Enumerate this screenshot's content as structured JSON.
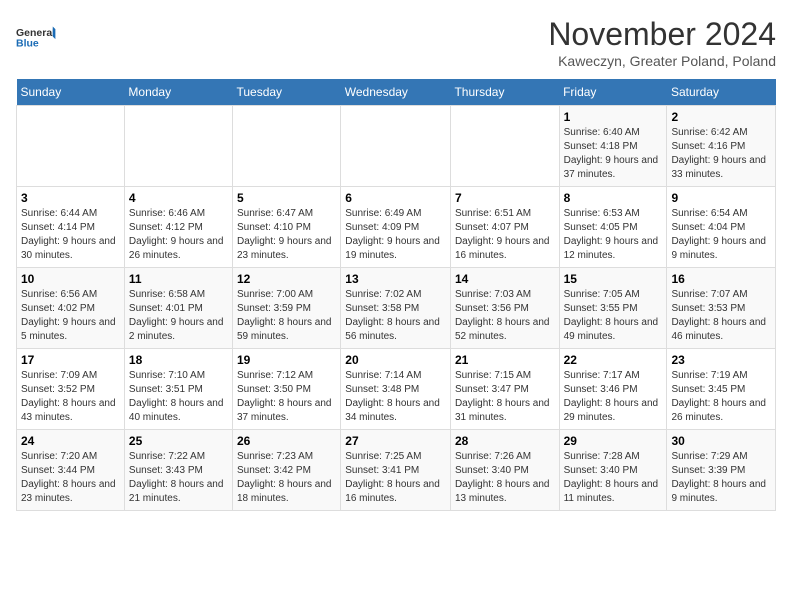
{
  "logo": {
    "line1": "General",
    "line2": "Blue"
  },
  "title": "November 2024",
  "subtitle": "Kaweczyn, Greater Poland, Poland",
  "days_of_week": [
    "Sunday",
    "Monday",
    "Tuesday",
    "Wednesday",
    "Thursday",
    "Friday",
    "Saturday"
  ],
  "weeks": [
    [
      {
        "day": "",
        "info": ""
      },
      {
        "day": "",
        "info": ""
      },
      {
        "day": "",
        "info": ""
      },
      {
        "day": "",
        "info": ""
      },
      {
        "day": "",
        "info": ""
      },
      {
        "day": "1",
        "info": "Sunrise: 6:40 AM\nSunset: 4:18 PM\nDaylight: 9 hours and 37 minutes."
      },
      {
        "day": "2",
        "info": "Sunrise: 6:42 AM\nSunset: 4:16 PM\nDaylight: 9 hours and 33 minutes."
      }
    ],
    [
      {
        "day": "3",
        "info": "Sunrise: 6:44 AM\nSunset: 4:14 PM\nDaylight: 9 hours and 30 minutes."
      },
      {
        "day": "4",
        "info": "Sunrise: 6:46 AM\nSunset: 4:12 PM\nDaylight: 9 hours and 26 minutes."
      },
      {
        "day": "5",
        "info": "Sunrise: 6:47 AM\nSunset: 4:10 PM\nDaylight: 9 hours and 23 minutes."
      },
      {
        "day": "6",
        "info": "Sunrise: 6:49 AM\nSunset: 4:09 PM\nDaylight: 9 hours and 19 minutes."
      },
      {
        "day": "7",
        "info": "Sunrise: 6:51 AM\nSunset: 4:07 PM\nDaylight: 9 hours and 16 minutes."
      },
      {
        "day": "8",
        "info": "Sunrise: 6:53 AM\nSunset: 4:05 PM\nDaylight: 9 hours and 12 minutes."
      },
      {
        "day": "9",
        "info": "Sunrise: 6:54 AM\nSunset: 4:04 PM\nDaylight: 9 hours and 9 minutes."
      }
    ],
    [
      {
        "day": "10",
        "info": "Sunrise: 6:56 AM\nSunset: 4:02 PM\nDaylight: 9 hours and 5 minutes."
      },
      {
        "day": "11",
        "info": "Sunrise: 6:58 AM\nSunset: 4:01 PM\nDaylight: 9 hours and 2 minutes."
      },
      {
        "day": "12",
        "info": "Sunrise: 7:00 AM\nSunset: 3:59 PM\nDaylight: 8 hours and 59 minutes."
      },
      {
        "day": "13",
        "info": "Sunrise: 7:02 AM\nSunset: 3:58 PM\nDaylight: 8 hours and 56 minutes."
      },
      {
        "day": "14",
        "info": "Sunrise: 7:03 AM\nSunset: 3:56 PM\nDaylight: 8 hours and 52 minutes."
      },
      {
        "day": "15",
        "info": "Sunrise: 7:05 AM\nSunset: 3:55 PM\nDaylight: 8 hours and 49 minutes."
      },
      {
        "day": "16",
        "info": "Sunrise: 7:07 AM\nSunset: 3:53 PM\nDaylight: 8 hours and 46 minutes."
      }
    ],
    [
      {
        "day": "17",
        "info": "Sunrise: 7:09 AM\nSunset: 3:52 PM\nDaylight: 8 hours and 43 minutes."
      },
      {
        "day": "18",
        "info": "Sunrise: 7:10 AM\nSunset: 3:51 PM\nDaylight: 8 hours and 40 minutes."
      },
      {
        "day": "19",
        "info": "Sunrise: 7:12 AM\nSunset: 3:50 PM\nDaylight: 8 hours and 37 minutes."
      },
      {
        "day": "20",
        "info": "Sunrise: 7:14 AM\nSunset: 3:48 PM\nDaylight: 8 hours and 34 minutes."
      },
      {
        "day": "21",
        "info": "Sunrise: 7:15 AM\nSunset: 3:47 PM\nDaylight: 8 hours and 31 minutes."
      },
      {
        "day": "22",
        "info": "Sunrise: 7:17 AM\nSunset: 3:46 PM\nDaylight: 8 hours and 29 minutes."
      },
      {
        "day": "23",
        "info": "Sunrise: 7:19 AM\nSunset: 3:45 PM\nDaylight: 8 hours and 26 minutes."
      }
    ],
    [
      {
        "day": "24",
        "info": "Sunrise: 7:20 AM\nSunset: 3:44 PM\nDaylight: 8 hours and 23 minutes."
      },
      {
        "day": "25",
        "info": "Sunrise: 7:22 AM\nSunset: 3:43 PM\nDaylight: 8 hours and 21 minutes."
      },
      {
        "day": "26",
        "info": "Sunrise: 7:23 AM\nSunset: 3:42 PM\nDaylight: 8 hours and 18 minutes."
      },
      {
        "day": "27",
        "info": "Sunrise: 7:25 AM\nSunset: 3:41 PM\nDaylight: 8 hours and 16 minutes."
      },
      {
        "day": "28",
        "info": "Sunrise: 7:26 AM\nSunset: 3:40 PM\nDaylight: 8 hours and 13 minutes."
      },
      {
        "day": "29",
        "info": "Sunrise: 7:28 AM\nSunset: 3:40 PM\nDaylight: 8 hours and 11 minutes."
      },
      {
        "day": "30",
        "info": "Sunrise: 7:29 AM\nSunset: 3:39 PM\nDaylight: 8 hours and 9 minutes."
      }
    ]
  ]
}
